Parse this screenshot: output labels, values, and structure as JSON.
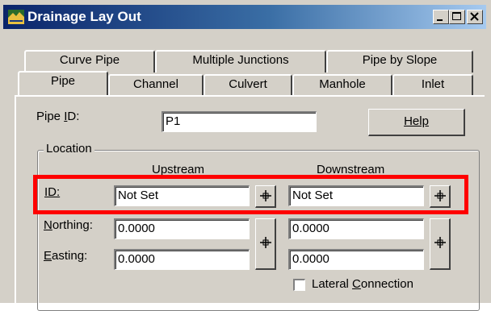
{
  "window": {
    "title": "Drainage Lay Out",
    "controls": [
      "minimize",
      "maximize",
      "close"
    ]
  },
  "tabs_back": [
    "Curve Pipe",
    "Multiple Junctions",
    "Pipe by Slope"
  ],
  "tabs_front": [
    "Pipe",
    "Channel",
    "Culvert",
    "Manhole",
    "Inlet"
  ],
  "active_tab": "Pipe",
  "pipe_id": {
    "label": "Pipe ID:",
    "value": "P1"
  },
  "help_button": "Help",
  "location": {
    "group_label": "Location",
    "upstream_header": "Upstream",
    "downstream_header": "Downstream",
    "rows": {
      "id": {
        "label": "ID:",
        "upstream": "Not Set",
        "downstream": "Not Set"
      },
      "northing": {
        "label": "Northing:",
        "upstream": "0.0000",
        "downstream": "0.0000"
      },
      "easting": {
        "label": "Easting:",
        "upstream": "0.0000",
        "downstream": "0.0000"
      }
    },
    "lateral_connection": {
      "label": "Lateral Connection",
      "checked": false
    }
  },
  "highlight_color": "#ff0000"
}
